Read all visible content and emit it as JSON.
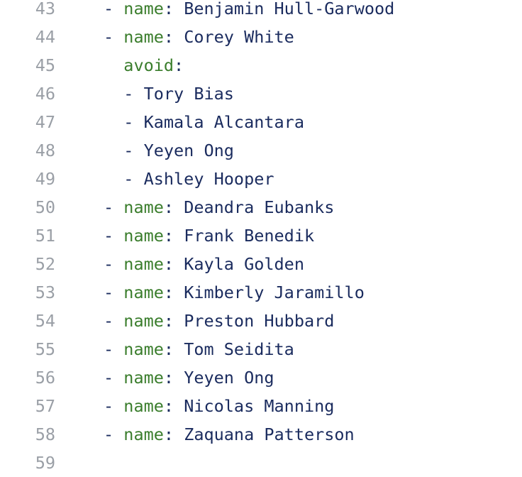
{
  "lines": [
    {
      "num": "43",
      "indent": "",
      "dash": "- ",
      "key": "name",
      "colon": ": ",
      "value": "Benjamin Hull-Garwood"
    },
    {
      "num": "44",
      "indent": "",
      "dash": "- ",
      "key": "name",
      "colon": ": ",
      "value": "Corey White"
    },
    {
      "num": "45",
      "indent": "  ",
      "dash": "",
      "key": "avoid",
      "colon": ":",
      "value": ""
    },
    {
      "num": "46",
      "indent": "  ",
      "dash": "- ",
      "key": "",
      "colon": "",
      "value": "Tory Bias"
    },
    {
      "num": "47",
      "indent": "  ",
      "dash": "- ",
      "key": "",
      "colon": "",
      "value": "Kamala Alcantara"
    },
    {
      "num": "48",
      "indent": "  ",
      "dash": "- ",
      "key": "",
      "colon": "",
      "value": "Yeyen Ong"
    },
    {
      "num": "49",
      "indent": "  ",
      "dash": "- ",
      "key": "",
      "colon": "",
      "value": "Ashley Hooper"
    },
    {
      "num": "50",
      "indent": "",
      "dash": "- ",
      "key": "name",
      "colon": ": ",
      "value": "Deandra Eubanks"
    },
    {
      "num": "51",
      "indent": "",
      "dash": "- ",
      "key": "name",
      "colon": ": ",
      "value": "Frank Benedik"
    },
    {
      "num": "52",
      "indent": "",
      "dash": "- ",
      "key": "name",
      "colon": ": ",
      "value": "Kayla Golden"
    },
    {
      "num": "53",
      "indent": "",
      "dash": "- ",
      "key": "name",
      "colon": ": ",
      "value": "Kimberly Jaramillo"
    },
    {
      "num": "54",
      "indent": "",
      "dash": "- ",
      "key": "name",
      "colon": ": ",
      "value": "Preston Hubbard"
    },
    {
      "num": "55",
      "indent": "",
      "dash": "- ",
      "key": "name",
      "colon": ": ",
      "value": "Tom Seidita"
    },
    {
      "num": "56",
      "indent": "",
      "dash": "- ",
      "key": "name",
      "colon": ": ",
      "value": "Yeyen Ong"
    },
    {
      "num": "57",
      "indent": "",
      "dash": "- ",
      "key": "name",
      "colon": ": ",
      "value": "Nicolas Manning"
    },
    {
      "num": "58",
      "indent": "",
      "dash": "- ",
      "key": "name",
      "colon": ": ",
      "value": "Zaquana Patterson"
    },
    {
      "num": "59",
      "indent": "",
      "dash": "",
      "key": "",
      "colon": "",
      "value": ""
    }
  ],
  "colors": {
    "line_number": "#9a9fa6",
    "key": "#3a7d2c",
    "text": "#1a2b5e",
    "background": "#ffffff"
  }
}
